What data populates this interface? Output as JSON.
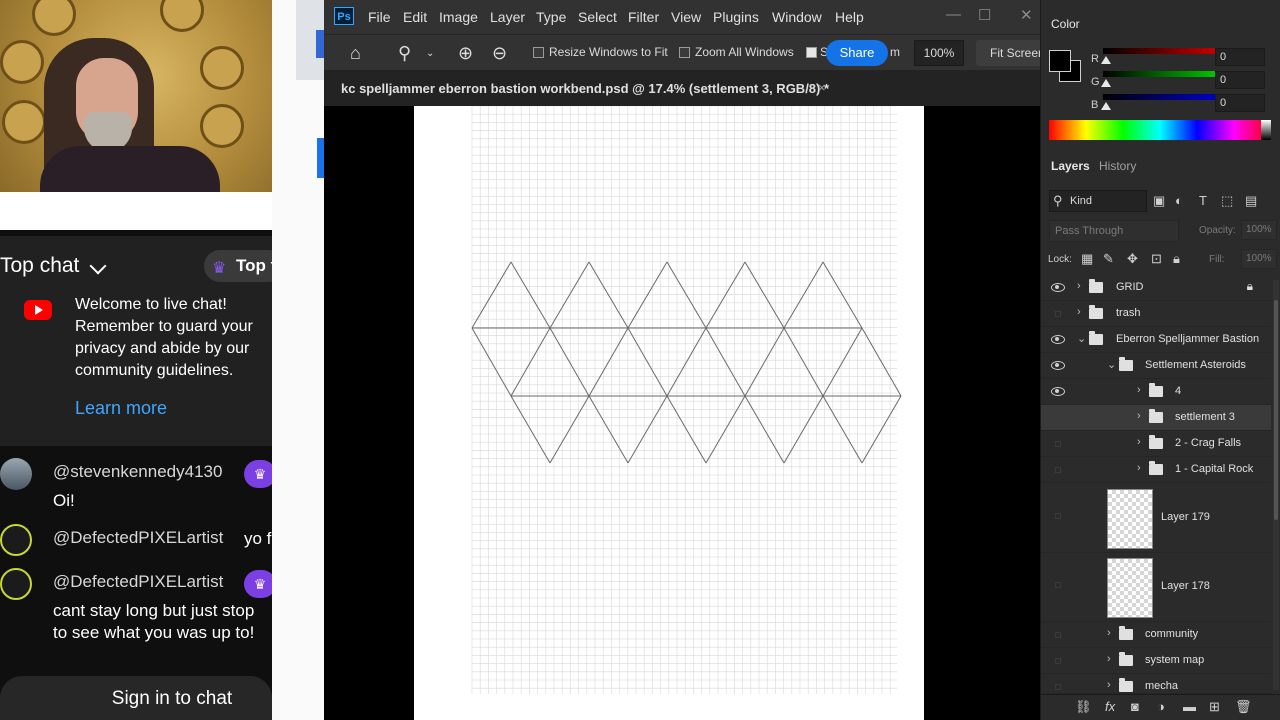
{
  "colors": {
    "ps_bg": "#2b2b2b",
    "ps_accent": "#1473e6",
    "chat_link": "#3ea6ff",
    "youtube_red": "#ff0000",
    "member_badge": "#7b3fe4"
  },
  "chat": {
    "header_title": "Top chat",
    "top_pill_label": "Top f",
    "welcome_text": "Welcome to live chat! Remember to guard your privacy and abide by our community guidelines.",
    "learn_more": "Learn more",
    "messages": [
      {
        "author": "@stevenkennedy4130",
        "text": "Oi!"
      },
      {
        "author": "@DefectedPIXELartist",
        "text": "yo f"
      },
      {
        "author": "@DefectedPIXELartist",
        "text": "cant stay long but just stop"
      },
      {
        "author": "",
        "text": "to see what you was up to!"
      }
    ],
    "sign_in": "Sign in to chat"
  },
  "photoshop": {
    "logo": "Ps",
    "menu": [
      "File",
      "Edit",
      "Image",
      "Layer",
      "Type",
      "Select",
      "Filter",
      "View",
      "Plugins",
      "Window",
      "Help"
    ],
    "options": {
      "resize_windows": "Resize Windows to Fit",
      "zoom_all_windows": "Zoom All Windows",
      "scrubby_zoom_partial": "S",
      "share": "Share",
      "zoom_partial": "m",
      "zoom_value": "100%",
      "fit_screen": "Fit Screen"
    },
    "document_tab": "kc spelljammer eberron bastion workbend.psd @ 17.4% (settlement 3, RGB/8) *",
    "close_glyph": "×",
    "panels": {
      "color_tab": "Color",
      "r_label": "R",
      "g_label": "G",
      "b_label": "B",
      "r_value": "0",
      "g_value": "0",
      "b_value": "0",
      "layers_tab": "Layers",
      "history_tab": "History",
      "kind_filter": "Kind",
      "blend_mode": "Pass Through",
      "opacity_label": "Opacity:",
      "opacity_value": "100%",
      "lock_label": "Lock:",
      "fill_label": "Fill:",
      "fill_value": "100%"
    },
    "layers": [
      {
        "name": "GRID",
        "visible": true,
        "locked": true
      },
      {
        "name": "trash",
        "visible": false
      },
      {
        "name": "Eberron Spelljammer Bastion",
        "visible": true
      },
      {
        "name": "Settlement Asteroids",
        "visible": true
      },
      {
        "name": "4",
        "visible": true
      },
      {
        "name": "settlement 3",
        "visible": false,
        "selected": true
      },
      {
        "name": "2 - Crag Falls",
        "visible": false
      },
      {
        "name": "1 - Capital Rock",
        "visible": false
      },
      {
        "name": "Layer 179",
        "visible": false
      },
      {
        "name": "Layer 178",
        "visible": false
      },
      {
        "name": "community",
        "visible": false
      },
      {
        "name": "system map",
        "visible": false
      },
      {
        "name": "mecha",
        "visible": false
      }
    ]
  }
}
